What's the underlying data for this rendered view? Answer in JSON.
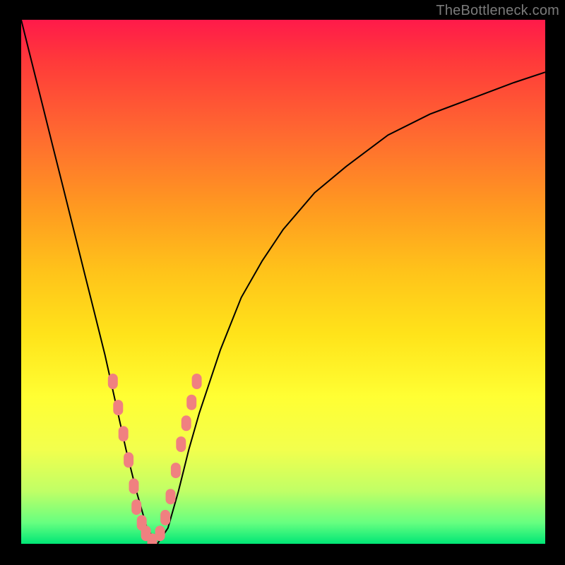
{
  "watermark": "TheBottleneck.com",
  "chart_data": {
    "type": "line",
    "title": "",
    "xlabel": "",
    "ylabel": "",
    "xlim": [
      0,
      100
    ],
    "ylim": [
      0,
      100
    ],
    "series": [
      {
        "name": "bottleneck-curve",
        "x": [
          0,
          2,
          4,
          6,
          8,
          10,
          12,
          14,
          16,
          18,
          20,
          22,
          24,
          26,
          28,
          30,
          32,
          34,
          38,
          42,
          46,
          50,
          56,
          62,
          70,
          78,
          86,
          94,
          100
        ],
        "y": [
          100,
          92,
          84,
          76,
          68,
          60,
          52,
          44,
          36,
          27,
          18,
          10,
          3,
          0,
          3,
          10,
          18,
          25,
          37,
          47,
          54,
          60,
          67,
          72,
          78,
          82,
          85,
          88,
          90
        ]
      }
    ],
    "markers": {
      "name": "highlighted-points",
      "x": [
        17.5,
        18.5,
        19.5,
        20.5,
        21.5,
        22.0,
        23.0,
        23.8,
        25.0,
        26.5,
        27.5,
        28.5,
        29.5,
        30.5,
        31.5,
        32.5,
        33.5
      ],
      "y": [
        31,
        26,
        21,
        16,
        11,
        7,
        4,
        2,
        0.5,
        2,
        5,
        9,
        14,
        19,
        23,
        27,
        31
      ]
    },
    "colors": {
      "curve": "#000000",
      "marker": "#f08080",
      "gradient_top": "#ff1a4a",
      "gradient_bottom": "#00e676"
    }
  }
}
